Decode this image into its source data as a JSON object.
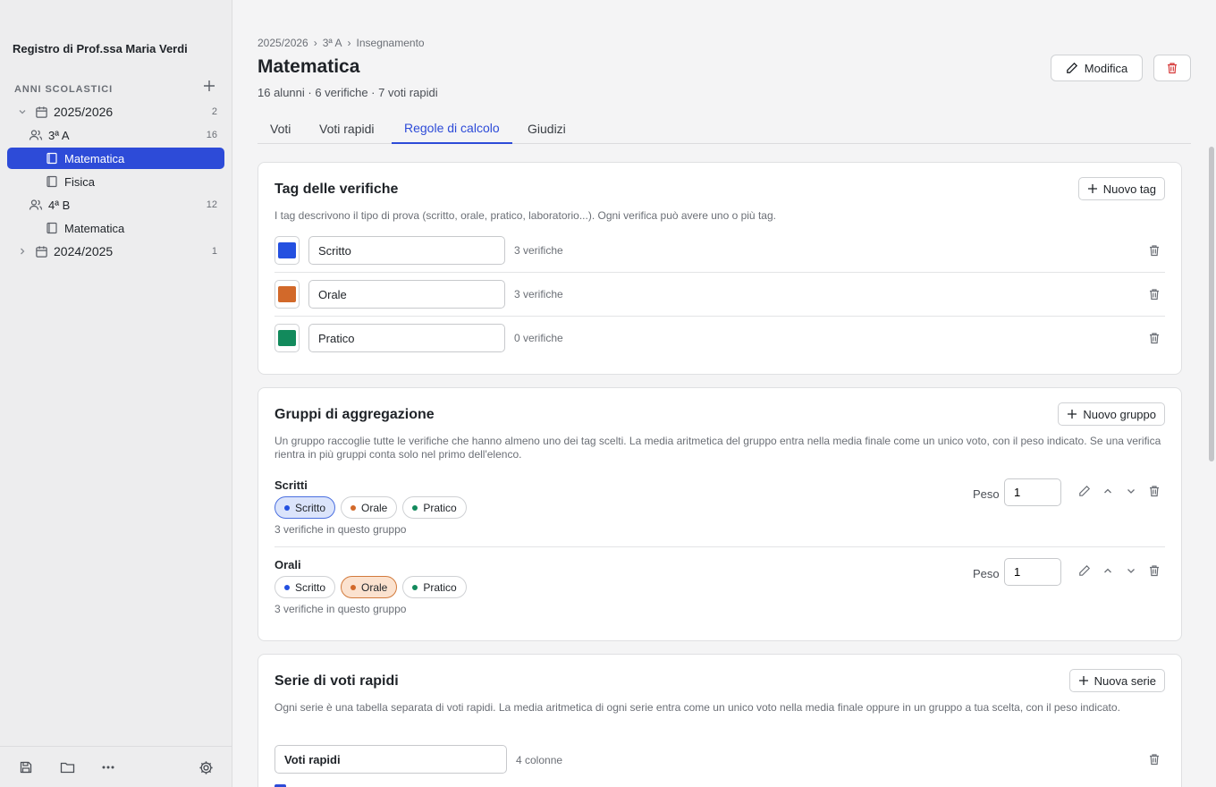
{
  "sidebar": {
    "app_title": "Registro di Prof.ssa Maria Verdi",
    "section_label": "ANNI SCOLASTICI",
    "years": [
      {
        "label": "2025/2026",
        "count": "2"
      },
      {
        "label": "2024/2025",
        "count": "1"
      }
    ],
    "classes": [
      {
        "label": "3ª A",
        "count": "16",
        "subjects": [
          "Matematica",
          "Fisica"
        ]
      },
      {
        "label": "4ª B",
        "count": "12",
        "subjects": [
          "Matematica"
        ]
      }
    ],
    "active_item": "Matematica"
  },
  "breadcrumb": [
    "2025/2026",
    "›",
    "3ª A",
    "›",
    "Insegnamento"
  ],
  "header": {
    "title": "Matematica",
    "meta": "16 alunni · 6 verifiche · 7 voti rapidi",
    "edit_label": "Modifica"
  },
  "tabs": [
    {
      "label": "Voti"
    },
    {
      "label": "Voti rapidi"
    },
    {
      "label": "Regole di calcolo"
    },
    {
      "label": "Giudizi"
    }
  ],
  "active_tab": "Regole di calcolo",
  "tags_card": {
    "title": "Tag delle verifiche",
    "new_label": "Nuovo tag",
    "description": "I tag descrivono il tipo di prova (scritto, orale, pratico, laboratorio...). Ogni verifica può avere uno o più tag.",
    "tags": [
      {
        "name": "Scritto",
        "count": "3 verifiche",
        "color": "#2450e0"
      },
      {
        "name": "Orale",
        "count": "3 verifiche",
        "color": "#d2692a"
      },
      {
        "name": "Pratico",
        "count": "0 verifiche",
        "color": "#128a5c"
      }
    ]
  },
  "groups_card": {
    "title": "Gruppi di aggregazione",
    "new_label": "Nuovo gruppo",
    "description": "Un gruppo raccoglie tutte le verifiche che hanno almeno uno dei tag scelti. La media aritmetica del gruppo entra nella media finale come un unico voto, con il peso indicato. Se una verifica rientra in più gruppi conta solo nel primo dell'elenco.",
    "weight_label": "Peso",
    "groups": [
      {
        "name": "Scritti",
        "weight": "1",
        "count": "3 verifiche in questo gruppo",
        "selected": "Scritto",
        "chips": [
          "Scritto",
          "Orale",
          "Pratico"
        ]
      },
      {
        "name": "Orali",
        "weight": "1",
        "count": "3 verifiche in questo gruppo",
        "selected": "Orale",
        "chips": [
          "Scritto",
          "Orale",
          "Pratico"
        ]
      }
    ]
  },
  "series_card": {
    "title": "Serie di voti rapidi",
    "new_label": "Nuova serie",
    "description": "Ogni serie è una tabella separata di voti rapidi. La media aritmetica di ogni serie entra come un unico voto nella media finale oppure in un gruppo a tua scelta, con il peso indicato.",
    "series": [
      {
        "name": "Voti rapidi",
        "count": "4 colonne"
      }
    ]
  },
  "colors": {
    "accent": "#2d4bd8",
    "danger": "#d63a3a"
  }
}
